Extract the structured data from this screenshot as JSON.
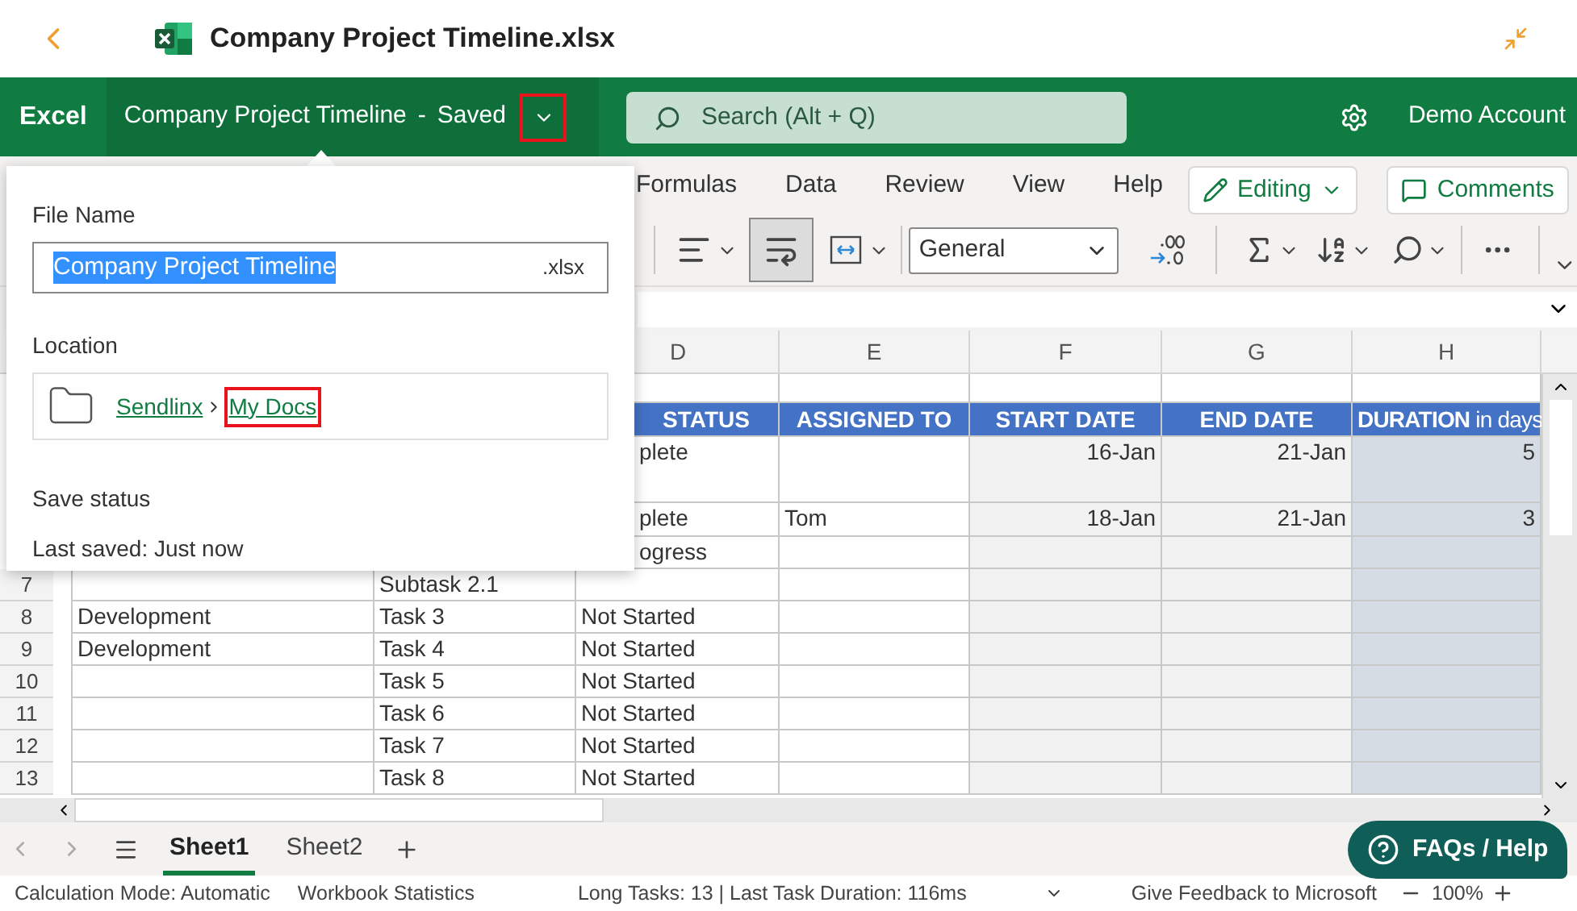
{
  "app_bar": {
    "title": "Company Project Timeline.xlsx"
  },
  "header": {
    "app_name": "Excel",
    "document": "Company Project Timeline",
    "separator": "-",
    "save_state": "Saved",
    "search": {
      "placeholder": "Search (Alt + Q)"
    },
    "account": "Demo Account"
  },
  "ribbon": {
    "tabs": [
      {
        "label": "Formulas",
        "selected": false
      },
      {
        "label": "Data",
        "selected": false
      },
      {
        "label": "Review",
        "selected": false
      },
      {
        "label": "View",
        "selected": false
      },
      {
        "label": "Help",
        "selected": false
      }
    ],
    "editing": "Editing",
    "comments": "Comments",
    "wrap_text_pressed": true,
    "number_format": "General"
  },
  "file_panel": {
    "file_name_label": "File Name",
    "file_name": "Company Project Timeline",
    "extension": ".xlsx",
    "location_label": "Location",
    "path": [
      "Sendlinx",
      "My Docs"
    ],
    "save_status_label": "Save status",
    "last_saved": "Last saved: Just now"
  },
  "grid": {
    "columns": [
      "D",
      "E",
      "F",
      "G",
      "H"
    ],
    "rows": [
      {
        "kind": "blank"
      },
      {
        "kind": "header",
        "D": "STATUS",
        "E": "ASSIGNED TO",
        "F": "START DATE",
        "G": "END DATE",
        "H": "DURATION",
        "H_note": "in days"
      },
      {
        "kind": "data",
        "D": "plete",
        "F": "16-Jan",
        "G": "21-Jan",
        "H": "5"
      },
      {
        "kind": "data",
        "D": "plete",
        "E": "Tom",
        "F": "18-Jan",
        "G": "21-Jan",
        "H": "3"
      },
      {
        "kind": "data",
        "D": "ogress"
      },
      {
        "kind": "data",
        "number": "7",
        "C": "Subtask 2.1"
      },
      {
        "kind": "data",
        "number": "8",
        "B": "Development",
        "C": "Task 3",
        "D": "Not Started"
      },
      {
        "kind": "data",
        "number": "9",
        "B": "Development",
        "C": "Task 4",
        "D": "Not Started"
      },
      {
        "kind": "data",
        "number": "10",
        "C": "Task 5",
        "D": "Not Started"
      },
      {
        "kind": "data",
        "number": "11",
        "C": "Task 6",
        "D": "Not Started"
      },
      {
        "kind": "data",
        "number": "12",
        "C": "Task 7",
        "D": "Not Started"
      },
      {
        "kind": "data",
        "number": "13",
        "C": "Task 8",
        "D": "Not Started"
      }
    ]
  },
  "sheets": [
    {
      "label": "Sheet1",
      "selected": true
    },
    {
      "label": "Sheet2",
      "selected": false
    }
  ],
  "help_button": "FAQs / Help",
  "status_bar": {
    "calculation": "Calculation Mode: Automatic",
    "statistics": "Workbook Statistics",
    "tasks": "Long Tasks: 13 | Last Task Duration: 116ms",
    "feedback": "Give Feedback to Microsoft",
    "zoom": "100%"
  }
}
